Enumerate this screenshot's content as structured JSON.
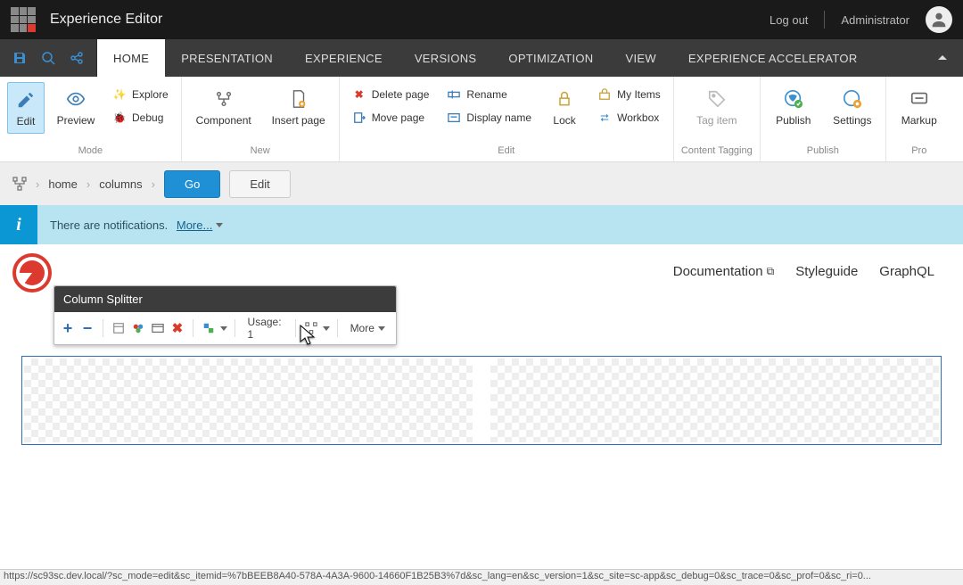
{
  "header": {
    "title": "Experience Editor",
    "logout": "Log out",
    "user": "Administrator"
  },
  "tabs": {
    "items": [
      "HOME",
      "PRESENTATION",
      "EXPERIENCE",
      "VERSIONS",
      "OPTIMIZATION",
      "VIEW",
      "EXPERIENCE ACCELERATOR"
    ],
    "active_index": 0
  },
  "ribbon": {
    "mode": {
      "label": "Mode",
      "edit": "Edit",
      "preview": "Preview",
      "explore": "Explore",
      "debug": "Debug"
    },
    "new": {
      "label": "New",
      "component": "Component",
      "insert_page": "Insert page"
    },
    "edit": {
      "label": "Edit",
      "delete_page": "Delete page",
      "move_page": "Move page",
      "rename": "Rename",
      "display_name": "Display name",
      "lock": "Lock",
      "my_items": "My Items",
      "workbox": "Workbox"
    },
    "tagging": {
      "label": "Content Tagging",
      "tag_item": "Tag item"
    },
    "publish": {
      "label": "Publish",
      "publish": "Publish",
      "settings": "Settings"
    },
    "proofing": {
      "label": "Pro",
      "markup": "Markup"
    }
  },
  "breadcrumb": {
    "items": [
      "home",
      "columns"
    ],
    "go": "Go",
    "edit": "Edit"
  },
  "notification": {
    "text": "There are notifications.",
    "link": "More..."
  },
  "page_nav": {
    "documentation": "Documentation",
    "styleguide": "Styleguide",
    "graphql": "GraphQL"
  },
  "component_chrome": {
    "title": "Column Splitter",
    "usage_label": "Usage:",
    "usage_count": "1",
    "more": "More"
  },
  "status_url": "https://sc93sc.dev.local/?sc_mode=edit&sc_itemid=%7bBEEB8A40-578A-4A3A-9600-14660F1B25B3%7d&sc_lang=en&sc_version=1&sc_site=sc-app&sc_debug=0&sc_trace=0&sc_prof=0&sc_ri=0..."
}
